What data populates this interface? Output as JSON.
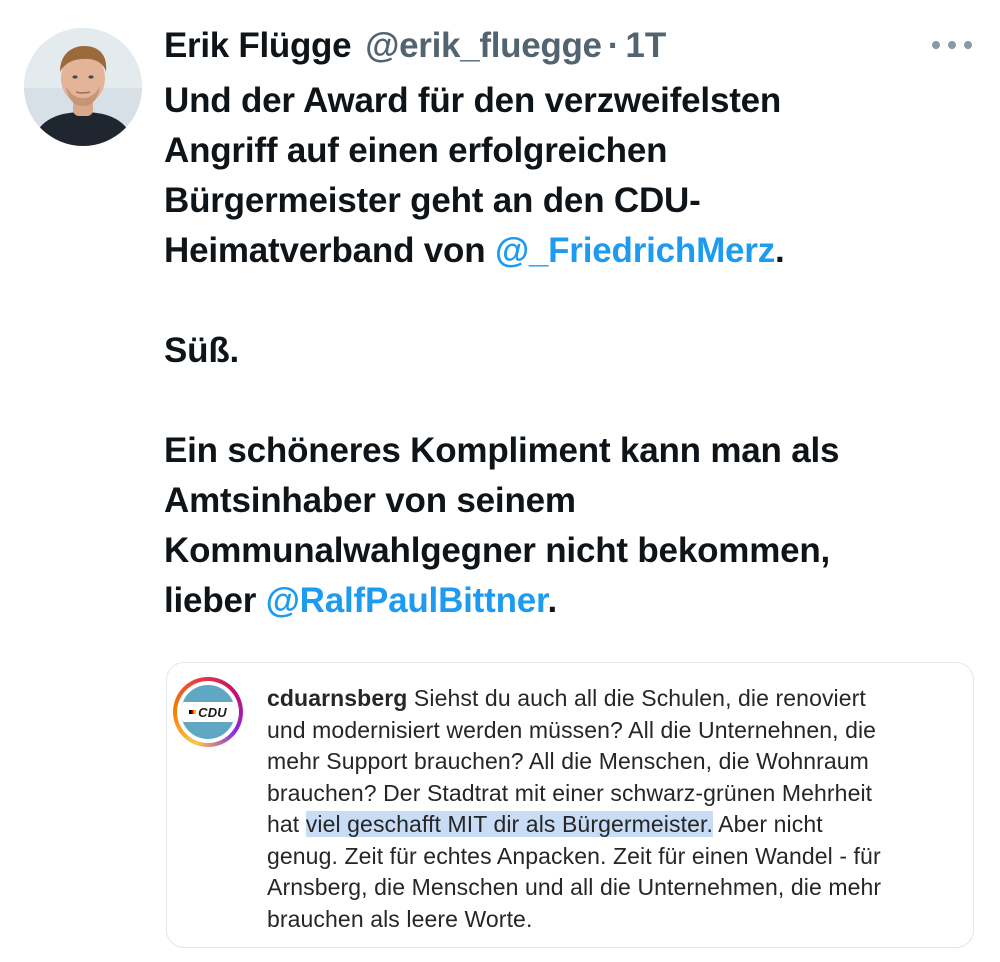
{
  "tweet": {
    "author": {
      "name": "Erik Flügge",
      "handle": "@erik_fluegge"
    },
    "separator": "·",
    "time": "1T",
    "text": {
      "p1_line1": "Und der Award für den verzweifelsten",
      "p1_line2": "Angriff auf einen erfolgreichen",
      "p1_line3": "Bürgermeister geht an den CDU-",
      "p1_line4_pre": "Heimatverband von ",
      "p1_mention": "@_FriedrichMerz",
      "p1_post": ".",
      "p2": "Süß.",
      "p3_line1": "Ein schöneres Kompliment kann man als",
      "p3_line2": "Amtsinhaber von seinem",
      "p3_line3": "Kommunalwahlgegner nicht bekommen,",
      "p3_line4_pre": "lieber ",
      "p3_mention": "@RalfPaulBittner",
      "p3_post": "."
    },
    "more_icon": "more-horizontal-icon"
  },
  "quote": {
    "avatar_logo_text": "CDU",
    "author": "cduarnsberg",
    "lines": [
      " Siehst du auch all die Schulen, die renoviert",
      "und modernisiert werden müssen? All die Unternehnen, die",
      "mehr Support brauchen? All die Menschen, die Wohnraum",
      "brauchen? Der Stadtrat mit einer schwarz-grünen Mehrheit"
    ],
    "line5_pre": "hat ",
    "line5_highlight": "viel geschafft MIT dir als Bürgermeister.",
    "line5_post": " Aber nicht",
    "lines_after": [
      "genug. Zeit für echtes Anpacken. Zeit für einen Wandel - für",
      "Arnsberg, die Menschen und all die Unternehmen, die mehr",
      "brauchen als leere Worte."
    ]
  },
  "colors": {
    "mention": "#1d9bf0",
    "muted": "#536471",
    "highlight": "#c9dcf5",
    "cdu_blue": "#5fa7c2"
  }
}
